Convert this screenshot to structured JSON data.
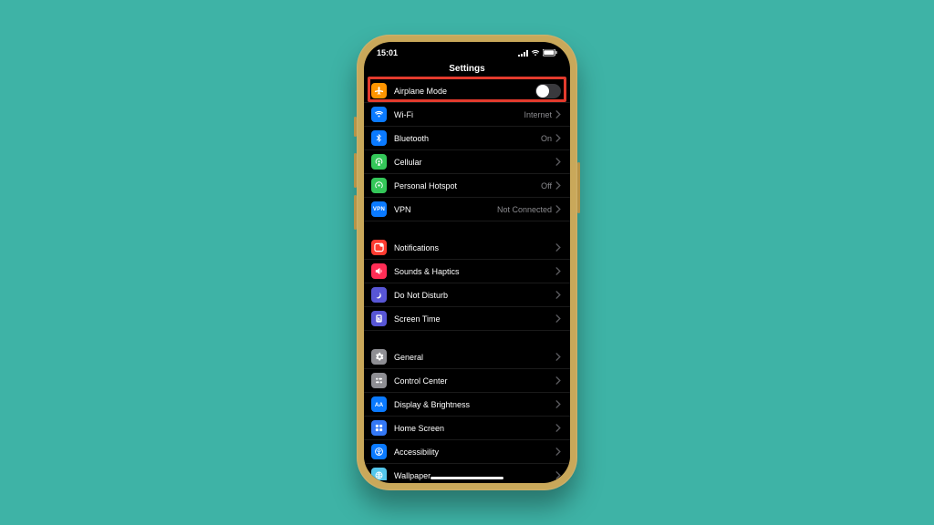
{
  "status": {
    "time": "15:01"
  },
  "header": {
    "title": "Settings"
  },
  "groups": [
    {
      "rows": [
        {
          "id": "airplane",
          "icon": "airplane-icon",
          "icon_bg": "#ff9500",
          "label": "Airplane Mode",
          "kind": "toggle",
          "toggle_on": false
        },
        {
          "id": "wifi",
          "icon": "wifi-icon",
          "icon_bg": "#0a7aff",
          "label": "Wi-Fi",
          "kind": "detail",
          "value": "Internet"
        },
        {
          "id": "bluetooth",
          "icon": "bluetooth-icon",
          "icon_bg": "#0a7aff",
          "label": "Bluetooth",
          "kind": "detail",
          "value": "On"
        },
        {
          "id": "cellular",
          "icon": "cellular-icon",
          "icon_bg": "#34c759",
          "label": "Cellular",
          "kind": "detail",
          "value": ""
        },
        {
          "id": "hotspot",
          "icon": "hotspot-icon",
          "icon_bg": "#34c759",
          "label": "Personal Hotspot",
          "kind": "detail",
          "value": "Off"
        },
        {
          "id": "vpn",
          "icon": "vpn-icon",
          "icon_bg": "#0a7aff",
          "label": "VPN",
          "kind": "detail",
          "value": "Not Connected"
        }
      ]
    },
    {
      "rows": [
        {
          "id": "notifications",
          "icon": "notifications-icon",
          "icon_bg": "#ff3b30",
          "label": "Notifications",
          "kind": "detail",
          "value": ""
        },
        {
          "id": "sounds",
          "icon": "sounds-icon",
          "icon_bg": "#ff2d55",
          "label": "Sounds & Haptics",
          "kind": "detail",
          "value": ""
        },
        {
          "id": "dnd",
          "icon": "dnd-icon",
          "icon_bg": "#5856d6",
          "label": "Do Not Disturb",
          "kind": "detail",
          "value": ""
        },
        {
          "id": "screentime",
          "icon": "screentime-icon",
          "icon_bg": "#5856d6",
          "label": "Screen Time",
          "kind": "detail",
          "value": ""
        }
      ]
    },
    {
      "rows": [
        {
          "id": "general",
          "icon": "general-icon",
          "icon_bg": "#8e8e93",
          "label": "General",
          "kind": "detail",
          "value": ""
        },
        {
          "id": "controlcenter",
          "icon": "controlcenter-icon",
          "icon_bg": "#8e8e93",
          "label": "Control Center",
          "kind": "detail",
          "value": ""
        },
        {
          "id": "display",
          "icon": "display-icon",
          "icon_bg": "#0a7aff",
          "label": "Display & Brightness",
          "kind": "detail",
          "value": ""
        },
        {
          "id": "homescreen",
          "icon": "homescreen-icon",
          "icon_bg": "#3478f6",
          "label": "Home Screen",
          "kind": "detail",
          "value": ""
        },
        {
          "id": "accessibility",
          "icon": "accessibility-icon",
          "icon_bg": "#0a7aff",
          "label": "Accessibility",
          "kind": "detail",
          "value": ""
        },
        {
          "id": "wallpaper",
          "icon": "wallpaper-icon",
          "icon_bg": "#54c7ec",
          "label": "Wallpaper",
          "kind": "detail",
          "value": ""
        }
      ]
    }
  ]
}
